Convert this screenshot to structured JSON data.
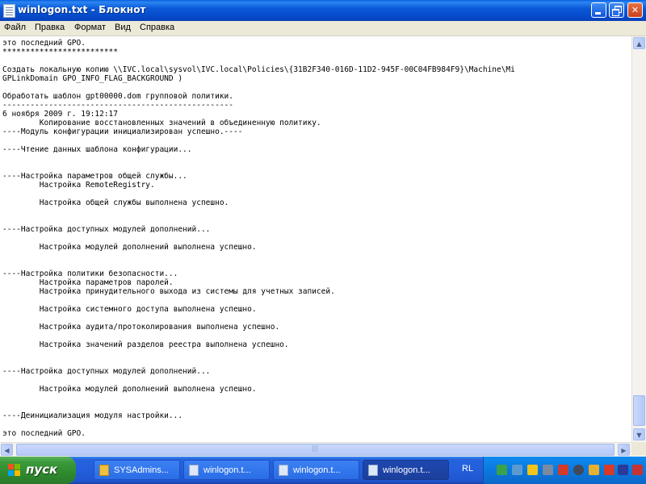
{
  "window": {
    "title": "winlogon.txt - Блокнот"
  },
  "menu": {
    "items": [
      "Файл",
      "Правка",
      "Формат",
      "Вид",
      "Справка"
    ]
  },
  "editor": {
    "lines": [
      "это последний GPO.",
      "*************************",
      "",
      "Создать локальную копию \\\\IVC.local\\sysvol\\IVC.local\\Policies\\{31B2F340-016D-11D2-945F-00C04FB984F9}\\Machine\\Mi",
      "GPLinkDomain GPO_INFO_FLAG_BACKGROUND )",
      "",
      "Обработать шаблон gpt00000.dom групповой политики.",
      "--------------------------------------------------",
      "6 ноября 2009 г. 19:12:17",
      "\tКопирование восстановленных значений в объединенную политику.",
      "----Модуль конфигурации инициализирован успешно.----",
      "",
      "----Чтение данных шаблона конфигурации...",
      "",
      "",
      "----Настройка параметров общей службы...",
      "\tНастройка RemoteRegistry.",
      "",
      "\tНастройка общей службы выполнена успешно.",
      "",
      "",
      "----Настройка доступных модулей дополнений...",
      "",
      "\tНастройка модулей дополнений выполнена успешно.",
      "",
      "",
      "----Настройка политики безопасности...",
      "\tНастройка параметров паролей.",
      "\tНастройка принудительного выхода из системы для учетных записей.",
      "",
      "\tНастройка системного доступа выполнена успешно.",
      "",
      "\tНастройка аудита/протоколирования выполнена успешно.",
      "",
      "\tНастройка значений разделов реестра выполнена успешно.",
      "",
      "",
      "----Настройка доступных модулей дополнений...",
      "",
      "\tНастройка модулей дополнений выполнена успешно.",
      "",
      "",
      "----Деинициализация модуля настройки...",
      "",
      "это последний GPO."
    ]
  },
  "taskbar": {
    "start_label": "пуск",
    "tasks": [
      {
        "label": "SYSAdmins...",
        "icon": "browser-icon",
        "active": false
      },
      {
        "label": "winlogon.t...",
        "icon": "notepad-icon",
        "active": false
      },
      {
        "label": "winlogon.t...",
        "icon": "notepad-icon",
        "active": false
      },
      {
        "label": "winlogon.t...",
        "icon": "notepad-icon",
        "active": true
      }
    ],
    "language": "RL",
    "tray_icons": [
      "network-icon",
      "sync-icon",
      "shield-icon",
      "network-disconnected-icon",
      "security-alert-icon",
      "antivirus-icon",
      "update-icon",
      "arrow-icon",
      "flag-icon",
      "firewall-icon"
    ]
  },
  "colors": {
    "titlebar": "#0a5ad8",
    "menubar": "#ece9d8",
    "taskbar": "#245edb",
    "start_button": "#3c9a3c"
  }
}
